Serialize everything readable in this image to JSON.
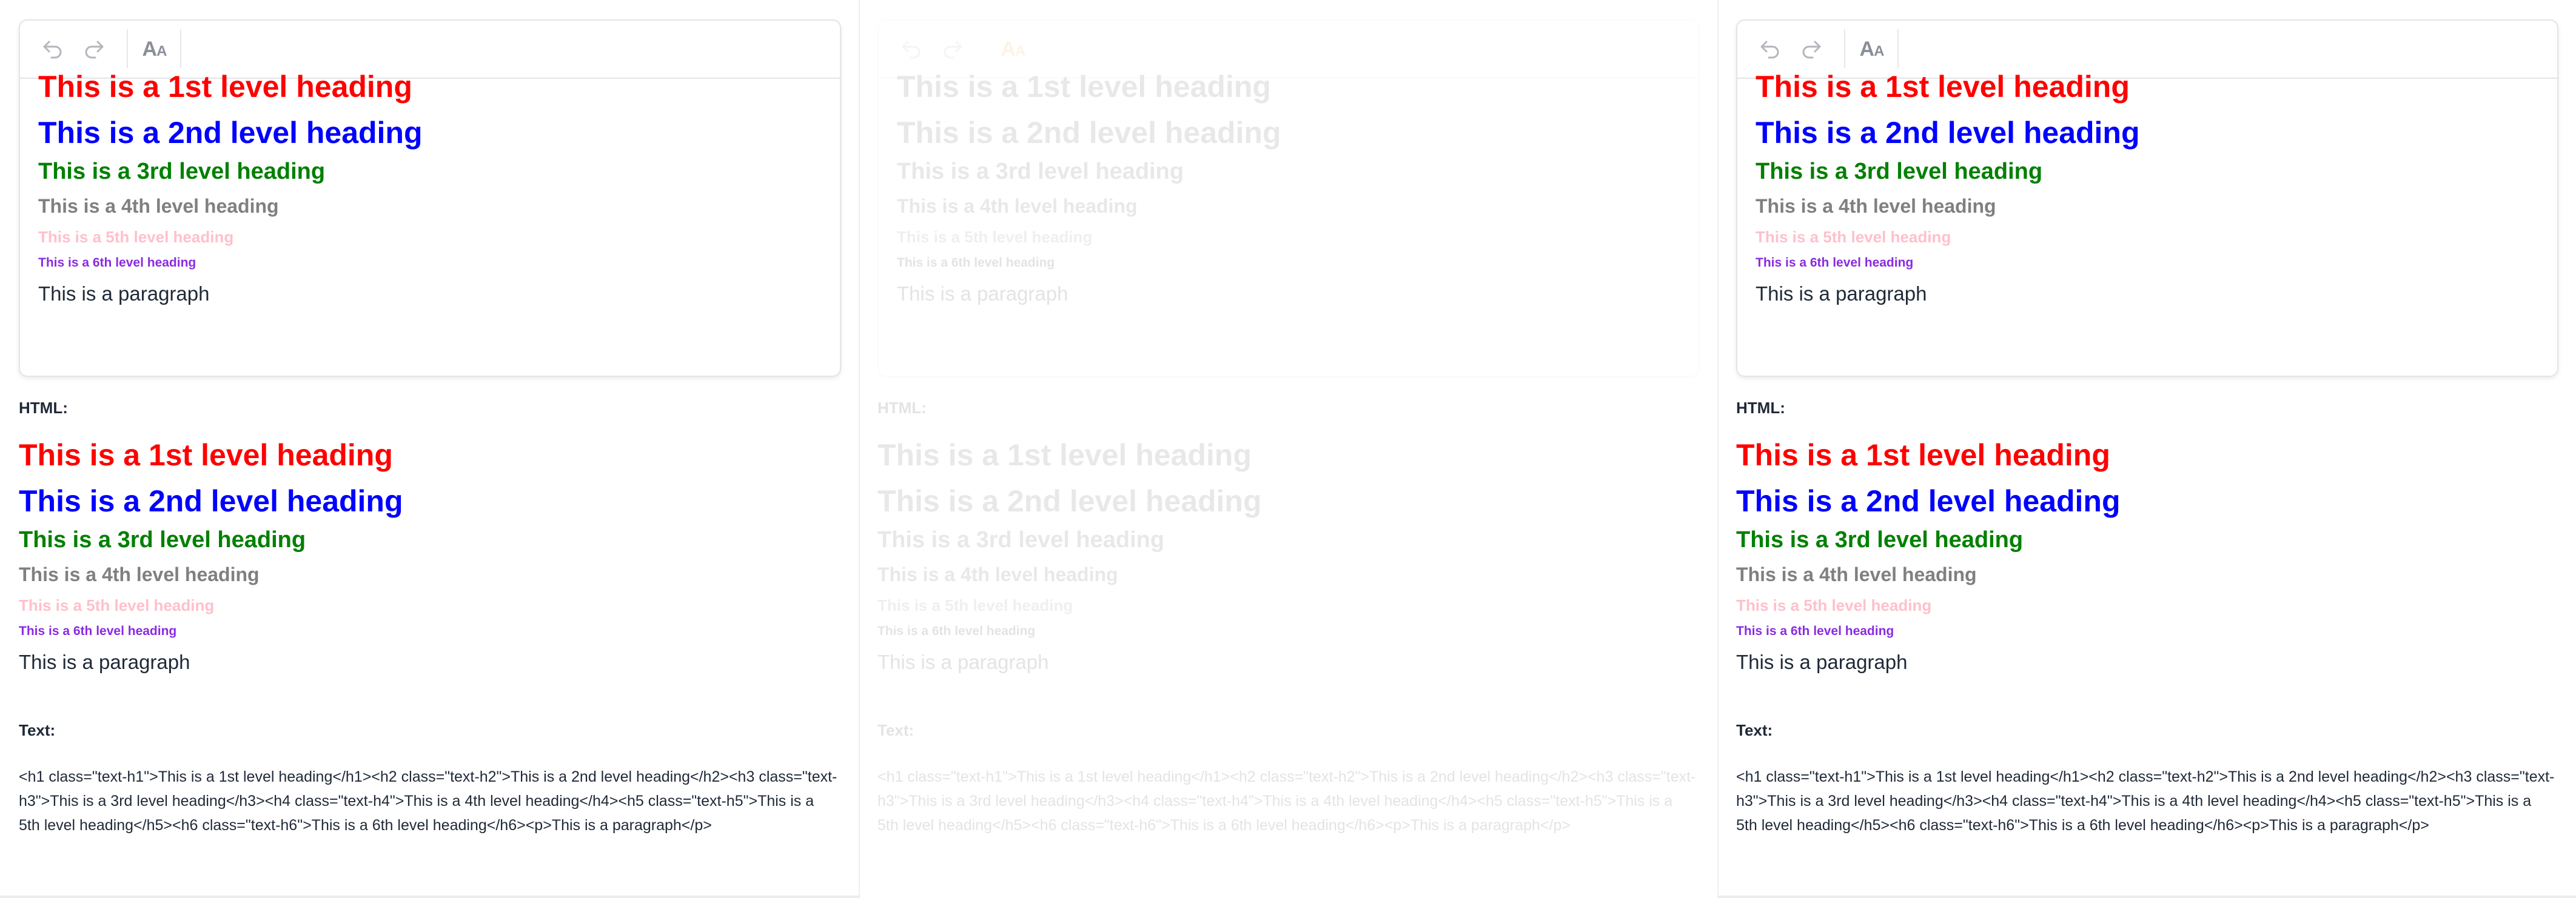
{
  "toolbar": {
    "undo_icon": "undo-icon",
    "redo_icon": "redo-icon",
    "format_icon": "text-size-icon",
    "format_big": "A",
    "format_small": "A"
  },
  "colors": {
    "h1": "#ff0000",
    "h2": "#0000ff",
    "h3": "#008000",
    "h4": "#808080",
    "h5": "#ffc0cb",
    "h6": "#8a2be2",
    "format_active": "#f2a93b"
  },
  "document": {
    "h1": "This is a 1st level heading",
    "h2": "This is a 2nd level heading",
    "h3": "This is a 3rd level heading",
    "h4": "This is a 4th level heading",
    "h5": "This is a 5th level heading",
    "h6": "This is a 6th level heading",
    "paragraph": "This is a paragraph"
  },
  "labels": {
    "html": "HTML:",
    "text": "Text:"
  },
  "source_text": "<h1 class=\"text-h1\">This is a 1st level heading</h1><h2 class=\"text-h2\">This is a 2nd level heading</h2><h3 class=\"text-h3\">This is a 3rd level heading</h3><h4 class=\"text-h4\">This is a 4th level heading</h4><h5 class=\"text-h5\">This is a 5th level heading</h5><h6 class=\"text-h6\">This is a 6th level heading</h6><p>This is a paragraph</p>"
}
